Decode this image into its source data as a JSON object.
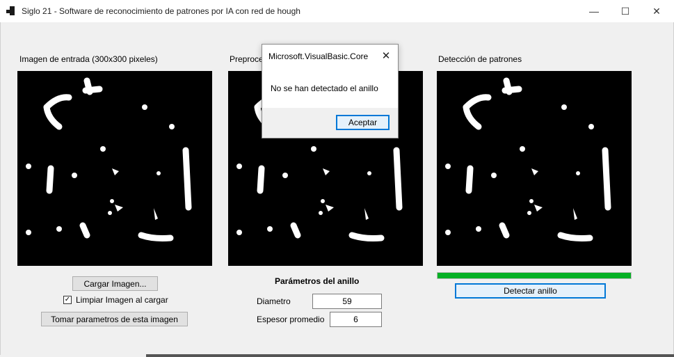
{
  "window": {
    "title": "Siglo 21 - Software de reconocimiento de patrones por IA con red de hough",
    "minimize_glyph": "—",
    "maximize_glyph": "☐",
    "close_glyph": "✕"
  },
  "panels": {
    "input_label": "Imagen de entrada (300x300 pixeles)",
    "preprocess_label": "Preproce",
    "detection_label": "Detección de patrones"
  },
  "left_controls": {
    "load_button": "Cargar Imagen...",
    "clean_checkbox_label": "Limpiar Imagen al cargar",
    "clean_checked": true,
    "take_params_button": "Tomar parametros de esta imagen"
  },
  "ring_params": {
    "heading": "Parámetros del anillo",
    "diameter_label": "Diametro",
    "diameter_value": "59",
    "thickness_label": "Espesor promedio",
    "thickness_value": "6"
  },
  "detection": {
    "progress_fraction": 1.0,
    "progress_color": "#06b025",
    "detect_button": "Detectar anillo"
  },
  "dialog": {
    "title": "Microsoft.VisualBasic.Core",
    "message": "No se han detectado el anillo",
    "ok_button": "Aceptar",
    "close_glyph": "✕"
  }
}
